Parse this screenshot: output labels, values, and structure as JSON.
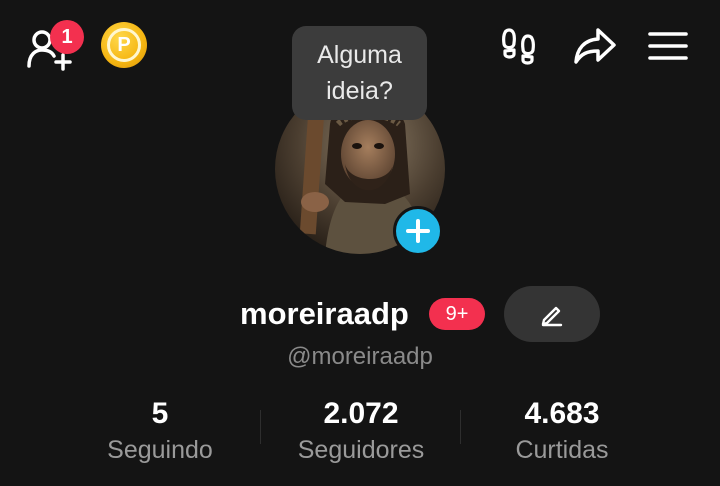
{
  "top_bar": {
    "notification_count": "1",
    "coin_letter": "P",
    "icons": [
      "add-friend-icon",
      "coin-icon",
      "footprints-icon",
      "share-icon",
      "menu-icon"
    ]
  },
  "tooltip": {
    "line1": "Alguma",
    "line2": "ideia?"
  },
  "profile": {
    "username": "moreiraadp",
    "badge": "9+",
    "handle": "@moreiraadp"
  },
  "stats": [
    {
      "value": "5",
      "label": "Seguindo"
    },
    {
      "value": "2.072",
      "label": "Seguidores"
    },
    {
      "value": "4.683",
      "label": "Curtidas"
    }
  ],
  "colors": {
    "background": "#141414",
    "badge_red": "#f3304f",
    "add_blue": "#20b8e8",
    "coin_gold": "#f5b511"
  }
}
